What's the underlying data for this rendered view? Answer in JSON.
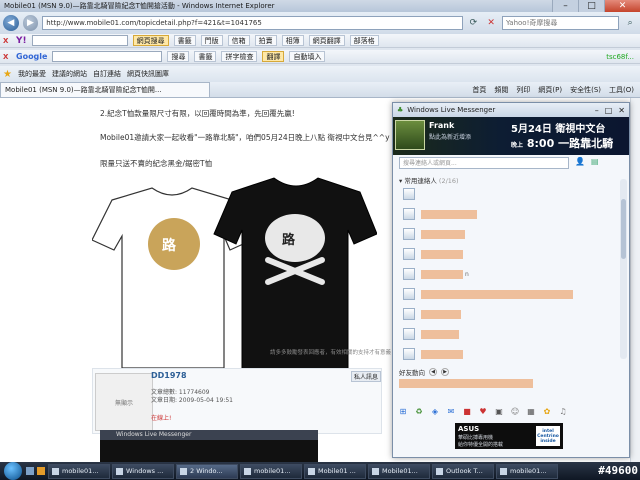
{
  "window": {
    "title": "Mobile01 (MSN 9.0)—路靠北騎冒險紀念T恤開搶活動 - Windows Internet Explorer",
    "minimize": "–",
    "maximize": "□",
    "close": "✕"
  },
  "address_bar": {
    "url": "http://www.mobile01.com/topicdetail.php?f=421&t=1041765",
    "search_placeholder": "Yahoo!奇摩搜尋"
  },
  "yahoo_toolbar": {
    "search_btn": "網頁搜尋",
    "items": [
      "書籤",
      "門版",
      "信箱",
      "拍賣",
      "相簿",
      "網頁翻譯",
      "部落格"
    ]
  },
  "google_toolbar": {
    "search_btn": "搜尋",
    "items": [
      "書籤",
      "拼字檢查",
      "翻譯",
      "自動填入"
    ],
    "user": "tsc68f..."
  },
  "favorites_bar": {
    "favorites": "我的最愛",
    "items": [
      "建議的網站",
      "自訂連結",
      "網頁快訊圖庫"
    ]
  },
  "tab": {
    "label": "Mobile01 (MSN 9.0)—路靠北騎冒險紀念T恤開...",
    "tools": [
      "首頁",
      "頻閱",
      "列印",
      "網頁(P)",
      "安全性(S)",
      "工具(O)"
    ]
  },
  "page": {
    "line1": "2.紀念T恤款量限尺寸有限，以回覆時間為準，先回覆先贏!",
    "line2": "Mobile01邀請大家一起收看\"一路靠北騎\"，咱們05月24日晚上八點 衛視中文台見^^y",
    "line3": "限量只送不賣的紀念黑金/鋸密T恤",
    "caption": "請多多鼓勵發表回應者，有效相關的支持才有意義"
  },
  "post": {
    "username": "DD1978",
    "avatar_text": "無顯示",
    "posts": "文章總數: 11774609",
    "date": "文章日期: 2009-05-04 19:51",
    "online": "在線上!",
    "msg": "私人訊息"
  },
  "embedded_messenger": {
    "title": "Windows Live Messenger"
  },
  "messenger": {
    "title": "Windows Live Messenger",
    "user_name": "Frank",
    "user_status": "點此為新近增添",
    "ad_line1": "5月24日 衛視中文台",
    "ad_time_prefix": "晚上",
    "ad_time": "8:00",
    "ad_show": "一路靠北騎",
    "search_placeholder": "搜尋連絡人或網頁...",
    "group_label": "常用連絡人",
    "group_count": "(2/16)",
    "contact_suffix": "n",
    "activity_label": "好友動向",
    "ad_brand": "ASUS",
    "ad_text1": "華碩比搏專用機",
    "ad_text2": "給你特優全開的搭載",
    "ad_intel": "intel Centrino inside"
  },
  "taskbar": {
    "tasks": [
      "mobile01...",
      "Windows ...",
      "2 Windo...",
      "mobile01...",
      "Mobile01 ...",
      "Mobile01...",
      "Outlook T...",
      "mobile01..."
    ],
    "watermark": "#49600"
  },
  "colors": {
    "redaction": "#eebf9c",
    "accent": "#2d5f96"
  }
}
